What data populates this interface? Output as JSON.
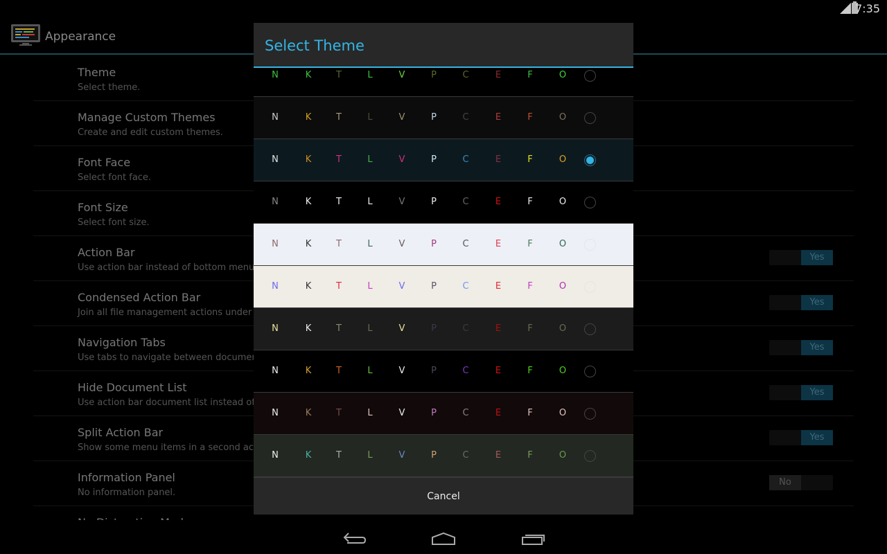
{
  "status": {
    "time": "7:35",
    "network": "3G"
  },
  "actionbar": {
    "title": "Appearance",
    "icon": "monitor-icon"
  },
  "settings": [
    {
      "title": "Theme",
      "summary": "Select theme."
    },
    {
      "title": "Manage Custom Themes",
      "summary": "Create and edit custom themes."
    },
    {
      "title": "Font Face",
      "summary": "Select font face."
    },
    {
      "title": "Font Size",
      "summary": "Select font size."
    },
    {
      "title": "Action Bar",
      "summary": "Use action bar instead of bottom menu.",
      "toggle": "Yes"
    },
    {
      "title": "Condensed Action Bar",
      "summary": "Join all file management actions under a s",
      "toggle": "Yes"
    },
    {
      "title": "Navigation Tabs",
      "summary": "Use tabs to navigate between documents",
      "toggle": "Yes"
    },
    {
      "title": "Hide Document List",
      "summary": "Use action bar document list instead of rig",
      "toggle": "Yes"
    },
    {
      "title": "Split Action Bar",
      "summary": "Show some menu items in a second actio",
      "toggle": "Yes"
    },
    {
      "title": "Information Panel",
      "summary": "No information panel.",
      "toggle": "No"
    },
    {
      "title": "No Distraction Mode",
      "summary": ""
    }
  ],
  "dialog": {
    "title": "Select Theme",
    "cancel": "Cancel",
    "letters": [
      "N",
      "K",
      "T",
      "L",
      "V",
      "P",
      "C",
      "E",
      "F",
      "O"
    ],
    "selected_index": 2,
    "themes": [
      {
        "bg": "#000000",
        "colors": [
          "#3fc23f",
          "#3fc23f",
          "#5a6a2a",
          "#3fc23f",
          "#6ad23a",
          "#5a6a2a",
          "#5a6a2a",
          "#8a2a2a",
          "#3fc23f",
          "#3fd23f"
        ]
      },
      {
        "bg": "#0c0c0c",
        "colors": [
          "#cccccc",
          "#d0a020",
          "#a09a80",
          "#4a4a3a",
          "#a09070",
          "#c0d8e8",
          "#444444",
          "#b03a3a",
          "#c05030",
          "#807060"
        ]
      },
      {
        "bg": "#0c1a20",
        "colors": [
          "#e0e0e0",
          "#d08a20",
          "#d0307a",
          "#4ab04a",
          "#d0307a",
          "#d0e8f0",
          "#3a8ac0",
          "#803040",
          "#e0e020",
          "#e0a020"
        ]
      },
      {
        "bg": "#000000",
        "colors": [
          "#888888",
          "#eeeeee",
          "#eeeeee",
          "#eeeeee",
          "#777777",
          "#eeeeee",
          "#666666",
          "#d01010",
          "#eeeeee",
          "#eeeeee"
        ]
      },
      {
        "bg": "#eef0f8",
        "colors": [
          "#8a6a6a",
          "#333333",
          "#8a6a6a",
          "#3a6a5a",
          "#6a5a5a",
          "#a03a7a",
          "#555555",
          "#e03a4a",
          "#4a7a5a",
          "#2a6a4a"
        ]
      },
      {
        "bg": "#f0ece6",
        "colors": [
          "#6a6af0",
          "#333333",
          "#e02a3a",
          "#c040c0",
          "#6a6af0",
          "#555566",
          "#6a9af0",
          "#e02a3a",
          "#c040c0",
          "#b030b0"
        ]
      },
      {
        "bg": "#1c1c1c",
        "colors": [
          "#e8e0a0",
          "#eeeeee",
          "#8a8a70",
          "#6a6a5a",
          "#e8e0a0",
          "#3a3a4a",
          "#3a3a3a",
          "#a01010",
          "#6a6a50",
          "#6a6a50"
        ]
      },
      {
        "bg": "#000000",
        "colors": [
          "#eeeeee",
          "#d0a030",
          "#d06020",
          "#6ac03a",
          "#eeeeee",
          "#4a4a5a",
          "#7a3ac0",
          "#d01010",
          "#50d020",
          "#50d020"
        ]
      },
      {
        "bg": "#120a0a",
        "colors": [
          "#eeeeee",
          "#9a7a5a",
          "#7a4a4a",
          "#e0c0c0",
          "#eeeeee",
          "#c07ac0",
          "#8a8080",
          "#c01010",
          "#e0c0c0",
          "#e0c0c0"
        ]
      },
      {
        "bg": "#232823",
        "colors": [
          "#eeeeee",
          "#4ab0a0",
          "#aaaaaa",
          "#7a9a5a",
          "#6a8ac0",
          "#d0a070",
          "#6a6a6a",
          "#a05a5a",
          "#7a9a5a",
          "#6a9a4a"
        ]
      }
    ]
  }
}
